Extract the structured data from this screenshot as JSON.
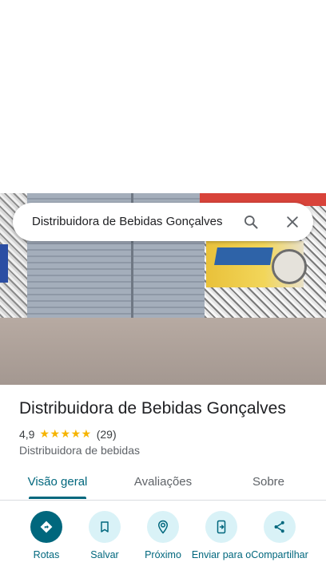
{
  "search": {
    "query": "Distribuidora de Bebidas Gonçalves"
  },
  "place": {
    "name": "Distribuidora de Bebidas Gonçalves",
    "rating": "4,9",
    "stars": "★★★★★",
    "reviews": "(29)",
    "category": "Distribuidora de bebidas"
  },
  "tabs": [
    {
      "label": "Visão geral"
    },
    {
      "label": "Avaliações"
    },
    {
      "label": "Sobre"
    }
  ],
  "actions": [
    {
      "label": "Rotas",
      "icon": "directions-icon"
    },
    {
      "label": "Salvar",
      "icon": "bookmark-icon"
    },
    {
      "label": "Próximo",
      "icon": "nearby-icon"
    },
    {
      "label": "Enviar para o",
      "icon": "send-to-phone-icon"
    },
    {
      "label": "Compartilhar",
      "icon": "share-icon"
    }
  ],
  "colors": {
    "accent": "#00677d",
    "accent_light": "#d9f2f7",
    "star": "#f6b400"
  }
}
